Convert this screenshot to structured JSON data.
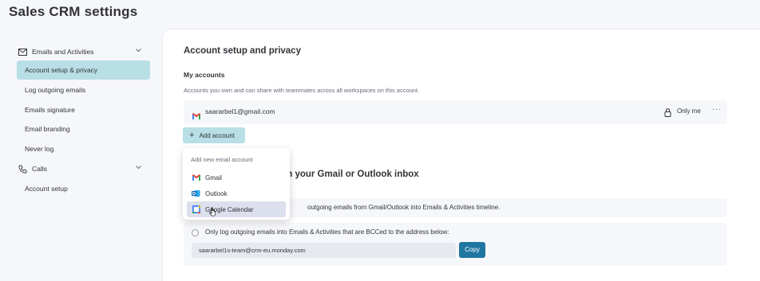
{
  "app": {
    "title": "Sales CRM settings"
  },
  "sidebar": {
    "groups": [
      {
        "label": "Emails and Activities",
        "icon": "mail-icon",
        "items": [
          {
            "label": "Account setup & privacy",
            "active": true
          },
          {
            "label": "Log outgoing emails"
          },
          {
            "label": "Emails signature"
          },
          {
            "label": "Email branding"
          },
          {
            "label": "Never log"
          }
        ]
      },
      {
        "label": "Calls",
        "icon": "phone-icon",
        "items": [
          {
            "label": "Account setup"
          }
        ]
      }
    ]
  },
  "main": {
    "section_title": "Account setup and privacy",
    "my_accounts": {
      "heading": "My accounts",
      "description": "Accounts you own and can share with teammates across all workspaces on this account.",
      "account": {
        "email": "saararbel1@gmail.com",
        "privacy": "Only me",
        "more": "···",
        "provider_icon": "gmail-icon"
      },
      "add_button": "Add account"
    },
    "log_section_title_visible": "om your Gmail or Outlook inbox",
    "options": [
      {
        "text": "outgoing emails from Gmail/Outlook into Emails & Activities timeline."
      },
      {
        "text": "Only log outgoing emails into Emails & Activities that are BCCed to the address below:"
      }
    ],
    "bcc_address": "saararbel1s-team@crm-eu.monday.com",
    "copy_button": "Copy"
  },
  "dropdown": {
    "title": "Add new email account",
    "items": [
      {
        "label": "Gmail",
        "icon": "gmail-icon"
      },
      {
        "label": "Outlook",
        "icon": "outlook-icon"
      },
      {
        "label": "Google Calendar",
        "icon": "google-calendar-icon",
        "hovered": true
      }
    ]
  },
  "colors": {
    "accent_light": "#b7dfe5",
    "primary_button": "#1f76a1",
    "background": "#f6f7fb"
  }
}
